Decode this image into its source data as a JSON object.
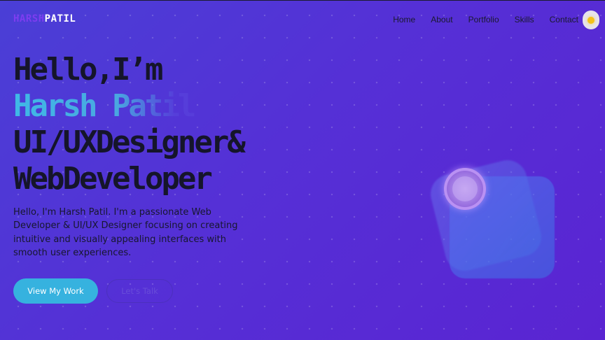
{
  "brand": {
    "first": "HARSH",
    "last": "PATIL"
  },
  "nav": {
    "items": [
      {
        "label": "Home"
      },
      {
        "label": "About"
      },
      {
        "label": "Portfolio"
      },
      {
        "label": "Skills"
      },
      {
        "label": "Contact"
      }
    ]
  },
  "theme_toggle": {
    "icon": "sun-icon"
  },
  "hero": {
    "greeting": "Hello,I’m",
    "name": "Harsh Patil",
    "role_line1": "UI/UXDesigner&",
    "role_line2": "WebDeveloper",
    "bio": "Hello, I'm Harsh Patil. I'm a passionate Web Developer & UI/UX Designer focusing on creating intuitive and visually appealing interfaces with smooth user experiences.",
    "primary_button": "View My Work",
    "secondary_button": "Let's Talk"
  },
  "colors": {
    "accent": "#36b2df",
    "brand_purple": "#7d3df0",
    "background": "#5230d6",
    "text_dark": "#15152a"
  }
}
